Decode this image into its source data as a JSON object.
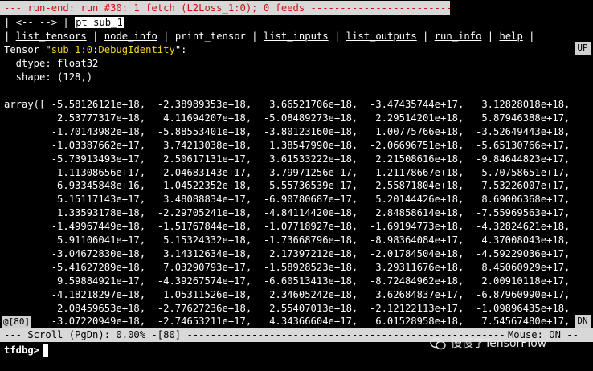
{
  "banner": {
    "text": "--- run-end: run #30: 1 fetch (L2Loss_1:0); 0 feeds --------------------------"
  },
  "nav": {
    "back": "<--",
    "forward": "-->",
    "command": "pt sub_1"
  },
  "menu": {
    "list_tensors": "list_tensors",
    "node_info": "node_info",
    "print_tensor": "print_tensor",
    "list_inputs": "list_inputs",
    "list_outputs": "list_outputs",
    "run_info": "run_info",
    "help": "help"
  },
  "tensor": {
    "prefix": "Tensor \"",
    "name": "sub_1:0",
    "colon": ":",
    "op": "DebugIdentity",
    "suffix": "\":",
    "dtype_label": "  dtype: float32",
    "shape_label": "  shape: (128,)"
  },
  "array_lines": [
    "array([ -5.58126121e+18,  -2.38989353e+18,   3.66521706e+18,  -3.47435744e+17,   3.12828018e+18,",
    "         2.53777317e+18,   4.11694207e+18,  -5.08489273e+18,   2.29514201e+18,   5.87946388e+17,",
    "        -1.70143982e+18,  -5.88553401e+18,  -3.80123160e+18,   1.00775766e+18,  -3.52649443e+18,",
    "        -1.03387662e+17,   3.74213038e+18,   1.38547990e+18,  -2.06696751e+18,  -5.65130766e+17,",
    "        -5.73913493e+17,   2.50617131e+17,   3.61533222e+18,   2.21508616e+18,  -9.84644823e+17,",
    "        -1.11308656e+17,   2.04683143e+17,   3.79971256e+17,   1.21178667e+18,  -5.70758651e+17,",
    "        -6.93345848e+16,   1.04522352e+18,  -5.55736539e+17,  -2.55871804e+18,   7.53226007e+17,",
    "         5.15117143e+17,   3.48088834e+17,  -6.90780687e+17,   5.20144426e+18,   8.69006368e+17,",
    "         1.33593178e+18,  -2.29705241e+18,  -4.84114420e+18,   2.84858614e+18,  -7.55969563e+17,",
    "        -1.49967449e+18,  -1.51767844e+18,  -1.07718927e+18,  -1.69194773e+18,  -4.32824621e+18,",
    "         5.91106041e+17,   5.15324332e+18,  -1.73668796e+18,  -8.98364084e+17,   4.37008043e+18,",
    "        -3.04672830e+18,   3.14312634e+18,   2.17397212e+18,  -2.01784504e+18,  -4.59229036e+17,",
    "        -5.41627289e+18,   7.03290793e+17,  -1.58928523e+18,   3.29311676e+18,   8.45060929e+17,",
    "         9.59884921e+17,  -4.39267574e+17,  -6.60513413e+18,  -8.72484962e+18,   2.00910118e+17,",
    "        -4.18218297e+18,   1.05311526e+18,   2.34605242e+18,   3.62684837e+17,  -6.87960990e+17,",
    "         2.08459653e+18,  -2.77627236e+18,   2.55407013e+18,  -2.12122113e+17,  -1.09896435e+18,",
    "        -3.07220949e+18,  -2.74653211e+17,   4.34366604e+17,   6.01528958e+18,   7.54567480e+17,"
  ],
  "scroll": {
    "up": "UP",
    "down": "DN",
    "marker": "@[80]",
    "status": "--- Scroll (PgDn): 0.00% -[80] -----------------------------------------------------------------",
    "mouse": "Mouse: ON --"
  },
  "prompt": {
    "text": "tfdbg>"
  },
  "watermark": {
    "text": "慢慢学TensorFlow"
  }
}
